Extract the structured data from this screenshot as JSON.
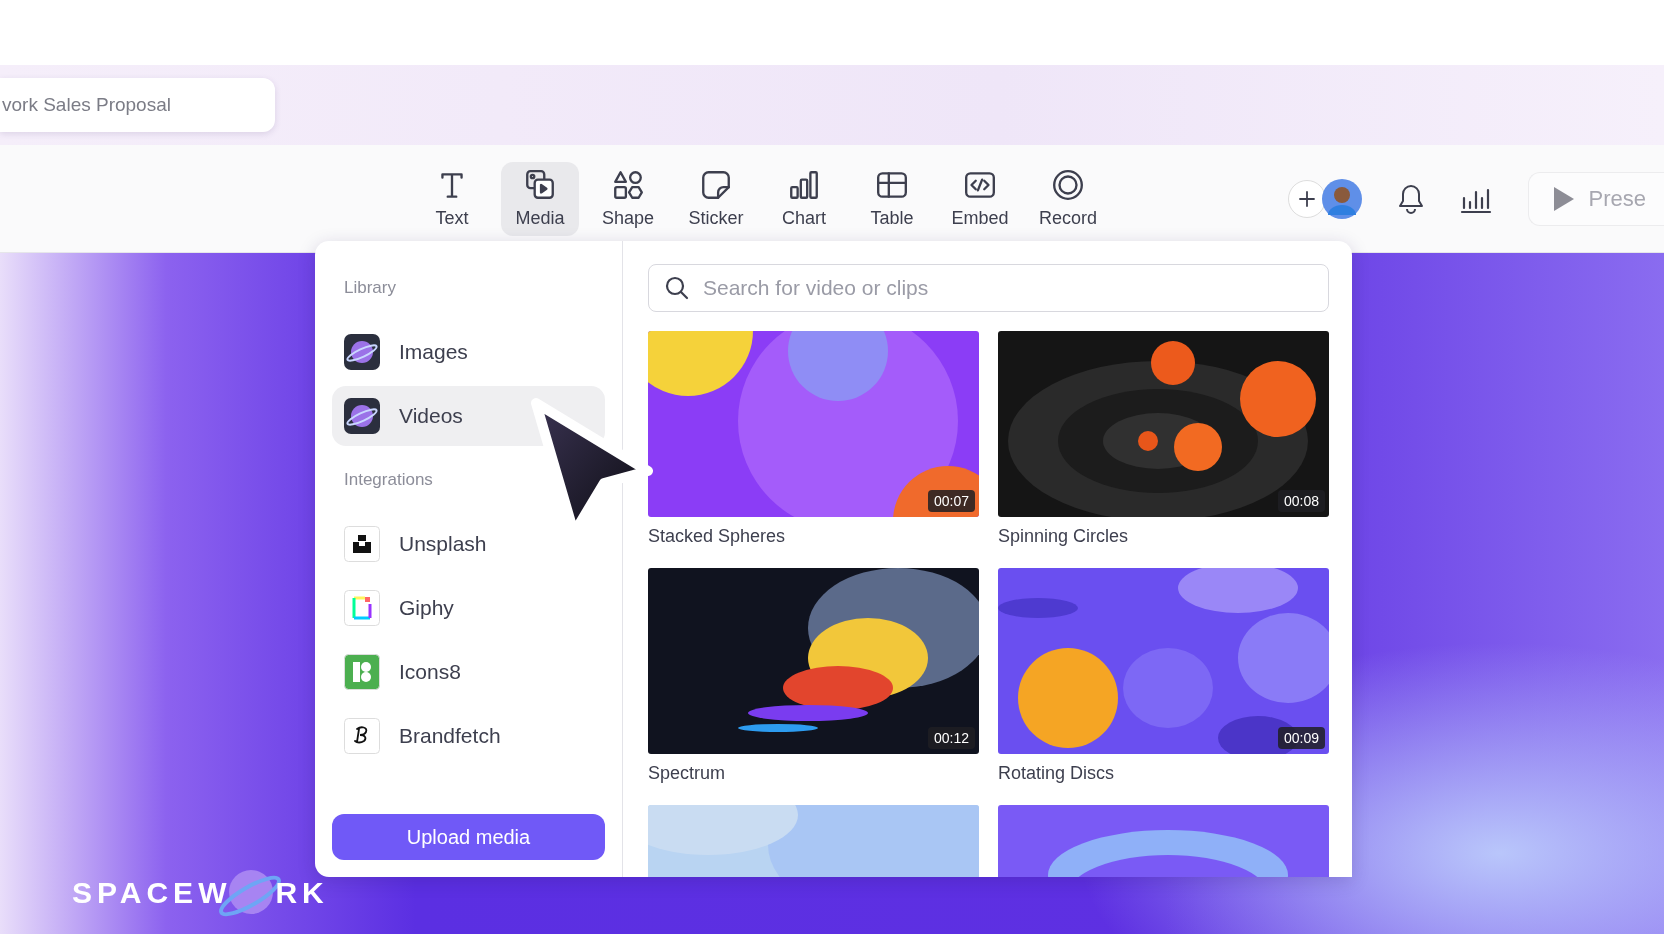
{
  "document": {
    "title": "vork Sales Proposal"
  },
  "toolbar": {
    "tools": [
      {
        "label": "Text",
        "selected": false
      },
      {
        "label": "Media",
        "selected": true
      },
      {
        "label": "Shape",
        "selected": false
      },
      {
        "label": "Sticker",
        "selected": false
      },
      {
        "label": "Chart",
        "selected": false
      },
      {
        "label": "Table",
        "selected": false
      },
      {
        "label": "Embed",
        "selected": false
      },
      {
        "label": "Record",
        "selected": false
      }
    ]
  },
  "header_actions": {
    "present_label": "Prese"
  },
  "media_panel": {
    "sections": [
      {
        "heading": "Library",
        "items": [
          {
            "label": "Images",
            "kind": "sw",
            "selected": false
          },
          {
            "label": "Videos",
            "kind": "sw",
            "selected": true
          }
        ]
      },
      {
        "heading": "Integrations",
        "items": [
          {
            "label": "Unsplash",
            "kind": "unsplash",
            "selected": false
          },
          {
            "label": "Giphy",
            "kind": "giphy",
            "selected": false
          },
          {
            "label": "Icons8",
            "kind": "icons8",
            "selected": false
          },
          {
            "label": "Brandfetch",
            "kind": "brandfetch",
            "selected": false
          }
        ]
      }
    ],
    "upload_button": "Upload media",
    "search": {
      "placeholder": "Search for video or clips"
    },
    "videos": [
      {
        "title": "Stacked Spheres",
        "duration": "00:07",
        "kind": "picture"
      },
      {
        "title": "Spinning Circles",
        "duration": "00:08",
        "kind": "picture"
      },
      {
        "title": "Spectrum",
        "duration": "00:12",
        "kind": "picture"
      },
      {
        "title": "Rotating Discs",
        "duration": "00:09",
        "kind": "picture"
      },
      {
        "kind": "picture"
      },
      {
        "kind": "picture"
      }
    ]
  },
  "brand": {
    "wordmark_start": "SPACEW",
    "wordmark_end": "RK"
  }
}
